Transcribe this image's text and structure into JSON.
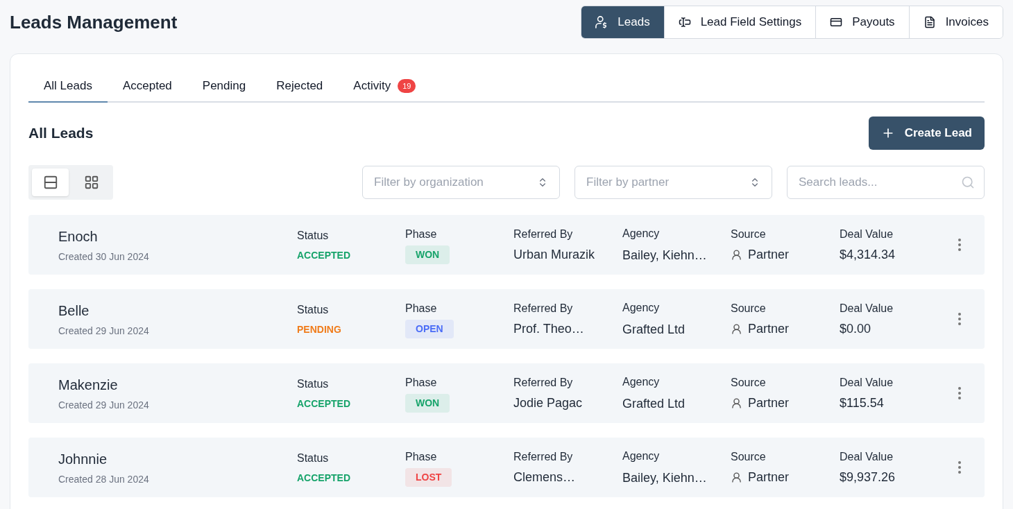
{
  "title": "Leads Management",
  "nav": [
    {
      "label": "Leads",
      "selected": true
    },
    {
      "label": "Lead Field Settings",
      "selected": false
    },
    {
      "label": "Payouts",
      "selected": false
    },
    {
      "label": "Invoices",
      "selected": false
    }
  ],
  "tabs": [
    {
      "label": "All Leads",
      "selected": true
    },
    {
      "label": "Accepted",
      "selected": false
    },
    {
      "label": "Pending",
      "selected": false
    },
    {
      "label": "Rejected",
      "selected": false
    },
    {
      "label": "Activity",
      "selected": false,
      "badge": "19"
    }
  ],
  "section_title": "All Leads",
  "create_button": {
    "label": "Create Lead"
  },
  "view_toggle": [
    {
      "selected": true
    },
    {
      "selected": false
    }
  ],
  "filters": [
    {
      "placeholder": "Filter by organization"
    },
    {
      "placeholder": "Filter by partner"
    }
  ],
  "search": {
    "placeholder": "Search leads..."
  },
  "leads": [
    {
      "name": "Enoch",
      "created": "Created 30 Jun 2024",
      "status_label": "Status",
      "status": {
        "label": "ACCEPTED",
        "color": "#16a36a"
      },
      "phase_label": "Phase",
      "phase": {
        "label": "WON",
        "color": "#16a36a"
      },
      "referred_by_label": "Referred By",
      "referred_by": "Urban Murazik",
      "agency_label": "Agency",
      "agency": "Bailey, Kiehn…",
      "source_label": "Source",
      "source": "Partner",
      "deal_value_label": "Deal Value",
      "deal_value": "$4,314.34"
    },
    {
      "name": "Belle",
      "created": "Created 29 Jun 2024",
      "status_label": "Status",
      "status": {
        "label": "PENDING",
        "color": "#f07c1b"
      },
      "phase_label": "Phase",
      "phase": {
        "label": "OPEN",
        "color": "#4a6cf7"
      },
      "referred_by_label": "Referred By",
      "referred_by": "Prof. Theo…",
      "agency_label": "Agency",
      "agency": "Grafted Ltd",
      "source_label": "Source",
      "source": "Partner",
      "deal_value_label": "Deal Value",
      "deal_value": "$0.00"
    },
    {
      "name": "Makenzie",
      "created": "Created 29 Jun 2024",
      "status_label": "Status",
      "status": {
        "label": "ACCEPTED",
        "color": "#16a36a"
      },
      "phase_label": "Phase",
      "phase": {
        "label": "WON",
        "color": "#16a36a"
      },
      "referred_by_label": "Referred By",
      "referred_by": "Jodie Pagac",
      "agency_label": "Agency",
      "agency": "Grafted Ltd",
      "source_label": "Source",
      "source": "Partner",
      "deal_value_label": "Deal Value",
      "deal_value": "$115.54"
    },
    {
      "name": "Johnnie",
      "created": "Created 28 Jun 2024",
      "status_label": "Status",
      "status": {
        "label": "ACCEPTED",
        "color": "#16a36a"
      },
      "phase_label": "Phase",
      "phase": {
        "label": "LOST",
        "color": "#ef4444"
      },
      "referred_by_label": "Referred By",
      "referred_by": "Clemens…",
      "agency_label": "Agency",
      "agency": "Bailey, Kiehn…",
      "source_label": "Source",
      "source": "Partner",
      "deal_value_label": "Deal Value",
      "deal_value": "$9,937.26"
    }
  ]
}
